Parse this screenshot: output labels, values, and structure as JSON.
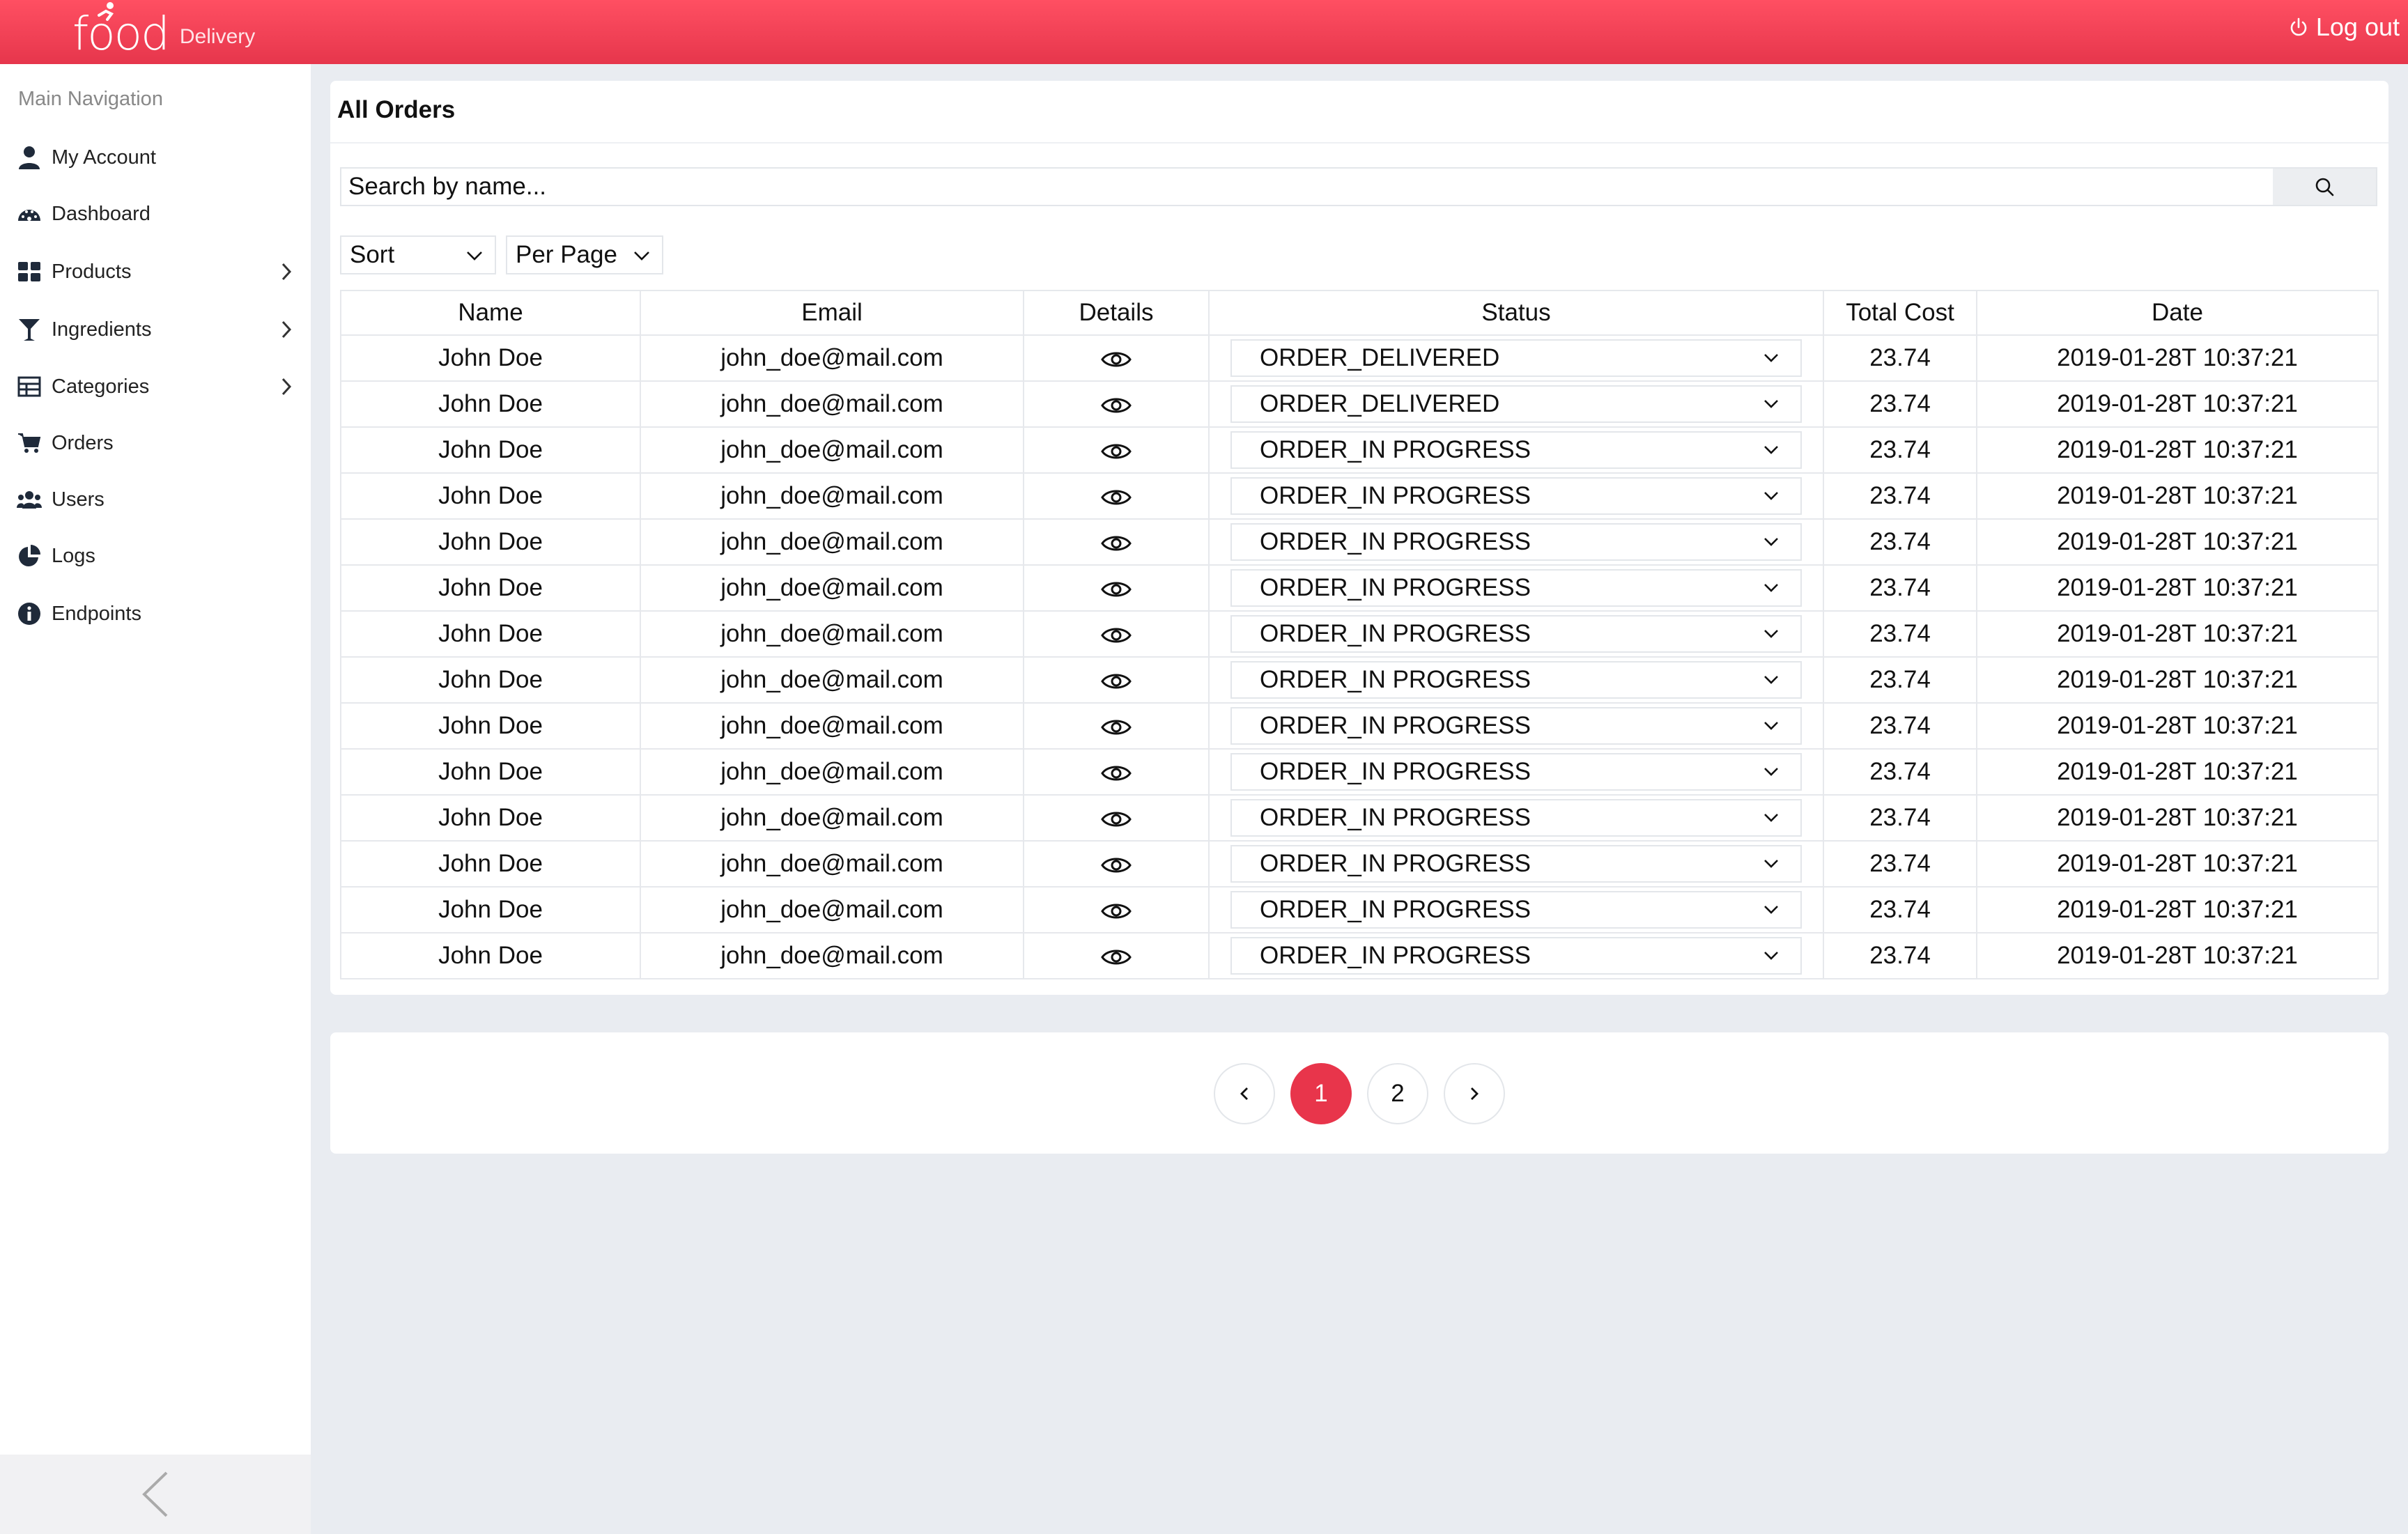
{
  "brand": {
    "logo_word": "food",
    "logo_sub": "Delivery",
    "color": "#e8354b"
  },
  "header": {
    "logout_label": "Log out"
  },
  "sidebar": {
    "heading": "Main Navigation",
    "items": [
      {
        "label": "My Account",
        "icon": "user-icon",
        "has_children": false
      },
      {
        "label": "Dashboard",
        "icon": "dashboard-icon",
        "has_children": false
      },
      {
        "label": "Products",
        "icon": "products-icon",
        "has_children": true
      },
      {
        "label": "Ingredients",
        "icon": "ingredients-icon",
        "has_children": true
      },
      {
        "label": "Categories",
        "icon": "categories-icon",
        "has_children": true
      },
      {
        "label": "Orders",
        "icon": "cart-icon",
        "has_children": false
      },
      {
        "label": "Users",
        "icon": "users-icon",
        "has_children": false
      },
      {
        "label": "Logs",
        "icon": "pie-chart-icon",
        "has_children": false
      },
      {
        "label": "Endpoints",
        "icon": "info-icon",
        "has_children": false
      }
    ]
  },
  "main": {
    "title": "All Orders",
    "search": {
      "placeholder": "Search by name..."
    },
    "sort_label": "Sort",
    "per_page_label": "Per Page",
    "table": {
      "columns": [
        "Name",
        "Email",
        "Details",
        "Status",
        "Total Cost",
        "Date"
      ],
      "rows": [
        [
          "John Doe",
          "john_doe@mail.com",
          "ORDER_DELIVERED",
          "23.74",
          "2019-01-28T 10:37:21"
        ],
        [
          "John Doe",
          "john_doe@mail.com",
          "ORDER_DELIVERED",
          "23.74",
          "2019-01-28T 10:37:21"
        ],
        [
          "John Doe",
          "john_doe@mail.com",
          "ORDER_IN PROGRESS",
          "23.74",
          "2019-01-28T 10:37:21"
        ],
        [
          "John Doe",
          "john_doe@mail.com",
          "ORDER_IN PROGRESS",
          "23.74",
          "2019-01-28T 10:37:21"
        ],
        [
          "John Doe",
          "john_doe@mail.com",
          "ORDER_IN PROGRESS",
          "23.74",
          "2019-01-28T 10:37:21"
        ],
        [
          "John Doe",
          "john_doe@mail.com",
          "ORDER_IN PROGRESS",
          "23.74",
          "2019-01-28T 10:37:21"
        ],
        [
          "John Doe",
          "john_doe@mail.com",
          "ORDER_IN PROGRESS",
          "23.74",
          "2019-01-28T 10:37:21"
        ],
        [
          "John Doe",
          "john_doe@mail.com",
          "ORDER_IN PROGRESS",
          "23.74",
          "2019-01-28T 10:37:21"
        ],
        [
          "John Doe",
          "john_doe@mail.com",
          "ORDER_IN PROGRESS",
          "23.74",
          "2019-01-28T 10:37:21"
        ],
        [
          "John Doe",
          "john_doe@mail.com",
          "ORDER_IN PROGRESS",
          "23.74",
          "2019-01-28T 10:37:21"
        ],
        [
          "John Doe",
          "john_doe@mail.com",
          "ORDER_IN PROGRESS",
          "23.74",
          "2019-01-28T 10:37:21"
        ],
        [
          "John Doe",
          "john_doe@mail.com",
          "ORDER_IN PROGRESS",
          "23.74",
          "2019-01-28T 10:37:21"
        ],
        [
          "John Doe",
          "john_doe@mail.com",
          "ORDER_IN PROGRESS",
          "23.74",
          "2019-01-28T 10:37:21"
        ],
        [
          "John Doe",
          "john_doe@mail.com",
          "ORDER_IN PROGRESS",
          "23.74",
          "2019-01-28T 10:37:21"
        ]
      ]
    }
  },
  "pagination": {
    "pages": [
      "1",
      "2"
    ],
    "current": "1"
  }
}
